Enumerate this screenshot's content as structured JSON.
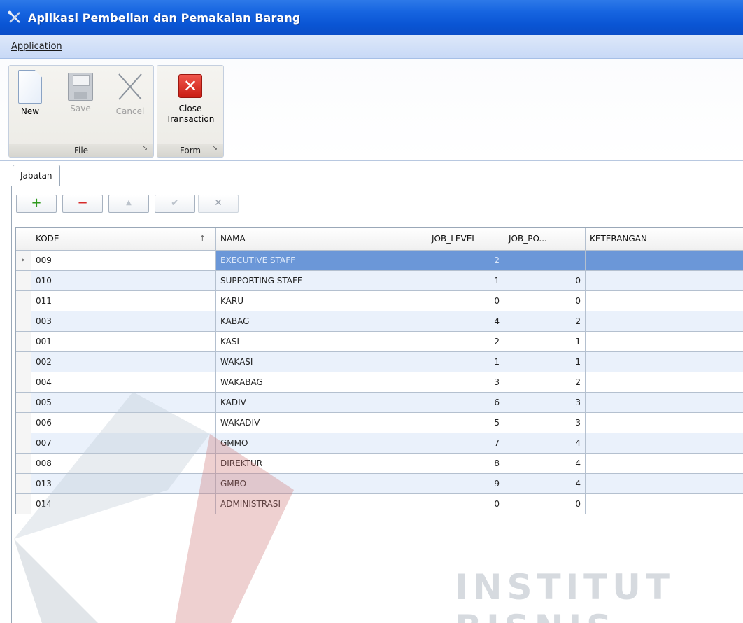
{
  "window": {
    "title": "Aplikasi Pembelian dan Pemakaian Barang",
    "icon": "tools-icon"
  },
  "menu": {
    "items": [
      "Application"
    ]
  },
  "ribbon": {
    "groups": [
      {
        "label": "File",
        "buttons": [
          {
            "label": "New",
            "icon": "new-document-icon",
            "enabled": true
          },
          {
            "label": "Save",
            "icon": "save-disk-icon",
            "enabled": false
          },
          {
            "label": "Cancel",
            "icon": "cancel-x-icon",
            "enabled": false
          }
        ]
      },
      {
        "label": "Form",
        "buttons": [
          {
            "label_line1": "Close",
            "label_line2": "Transaction",
            "icon": "close-red-icon",
            "enabled": true
          }
        ]
      }
    ]
  },
  "tabs": [
    {
      "label": "Jabatan",
      "active": true
    }
  ],
  "navigator": {
    "buttons": [
      {
        "symbol": "+",
        "name": "append-record",
        "enabled": true
      },
      {
        "symbol": "−",
        "name": "delete-record",
        "enabled": true
      },
      {
        "symbol": "▲",
        "name": "edit-record",
        "enabled": false
      },
      {
        "symbol": "✔",
        "name": "post-record",
        "enabled": false
      },
      {
        "symbol": "✕",
        "name": "cancel-record",
        "enabled": false
      }
    ]
  },
  "grid": {
    "columns": [
      "KODE",
      "NAMA",
      "JOB_LEVEL",
      "JOB_PO...",
      "KETERANGAN"
    ],
    "sort_column": "KODE",
    "sort_direction": "ascending",
    "selected_row": 0,
    "rows": [
      {
        "kode": "009",
        "nama": "EXECUTIVE STAFF",
        "job_level": "2",
        "job_pos": "",
        "keterangan": ""
      },
      {
        "kode": "010",
        "nama": "SUPPORTING STAFF",
        "job_level": "1",
        "job_pos": "0",
        "keterangan": ""
      },
      {
        "kode": "011",
        "nama": "KARU",
        "job_level": "0",
        "job_pos": "0",
        "keterangan": ""
      },
      {
        "kode": "003",
        "nama": "KABAG",
        "job_level": "4",
        "job_pos": "2",
        "keterangan": ""
      },
      {
        "kode": "001",
        "nama": "KASI",
        "job_level": "2",
        "job_pos": "1",
        "keterangan": ""
      },
      {
        "kode": "002",
        "nama": "WAKASI",
        "job_level": "1",
        "job_pos": "1",
        "keterangan": ""
      },
      {
        "kode": "004",
        "nama": "WAKABAG",
        "job_level": "3",
        "job_pos": "2",
        "keterangan": ""
      },
      {
        "kode": "005",
        "nama": "KADIV",
        "job_level": "6",
        "job_pos": "3",
        "keterangan": ""
      },
      {
        "kode": "006",
        "nama": "WAKADIV",
        "job_level": "5",
        "job_pos": "3",
        "keterangan": ""
      },
      {
        "kode": "007",
        "nama": "GMMO",
        "job_level": "7",
        "job_pos": "4",
        "keterangan": ""
      },
      {
        "kode": "008",
        "nama": "DIREKTUR",
        "job_level": "8",
        "job_pos": "4",
        "keterangan": ""
      },
      {
        "kode": "013",
        "nama": "GMBO",
        "job_level": "9",
        "job_pos": "4",
        "keterangan": ""
      },
      {
        "kode": "014",
        "nama": "ADMINISTRASI",
        "job_level": "0",
        "job_pos": "0",
        "keterangan": ""
      }
    ]
  },
  "watermark": {
    "text": "INSTITUT BISNIS"
  },
  "colors": {
    "titlebar": "#0a55d4",
    "selection": "#6b97d8",
    "alt_row": "#eaf1fb",
    "close_icon": "#c91d13"
  }
}
